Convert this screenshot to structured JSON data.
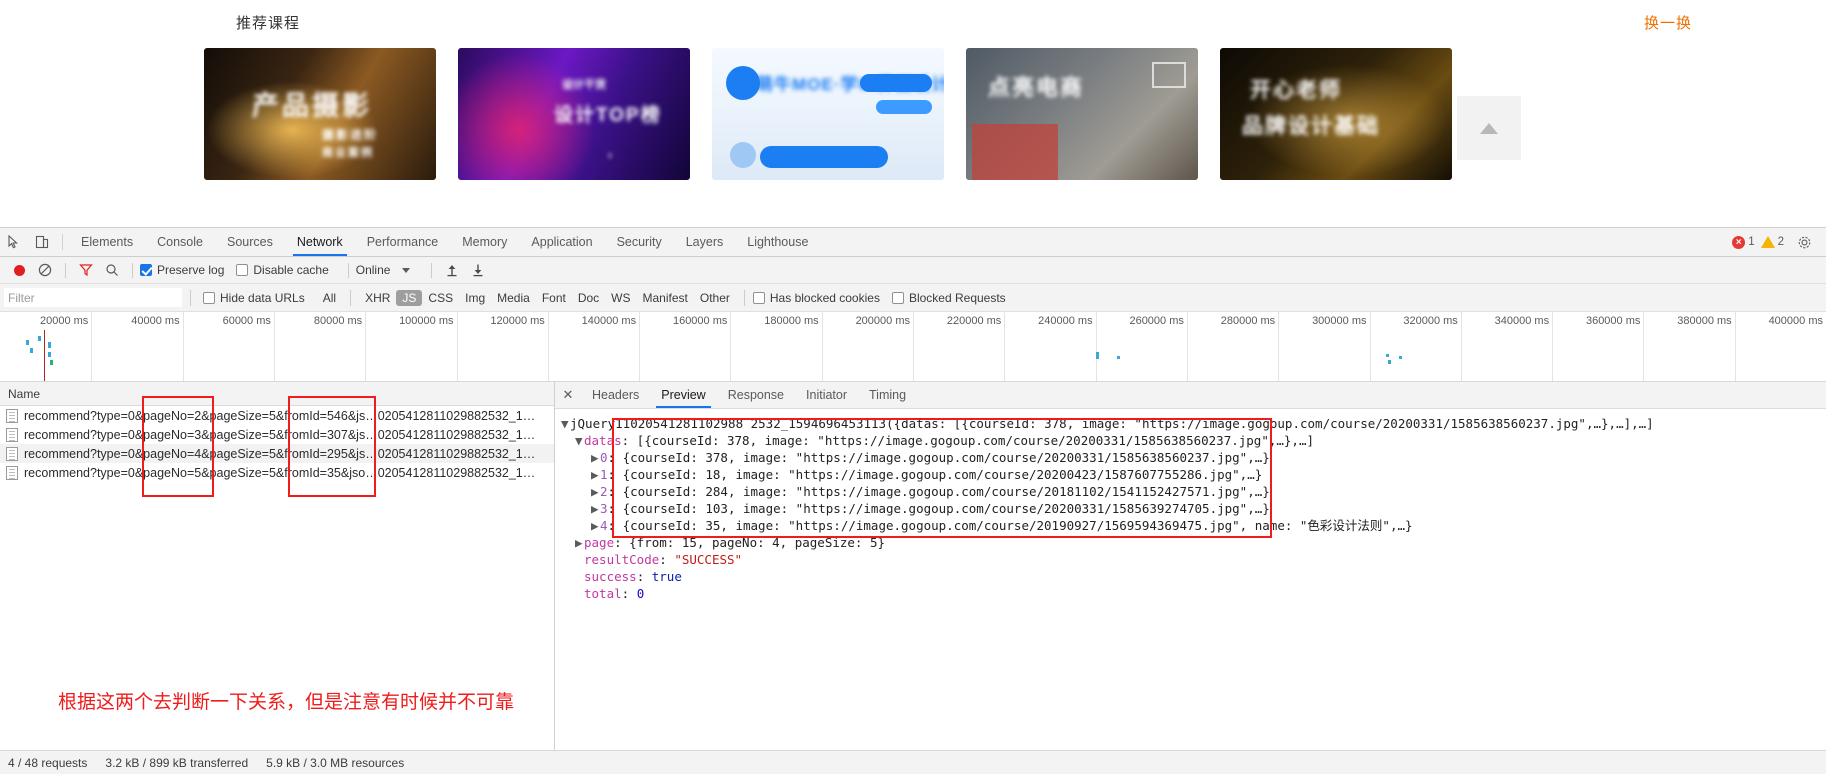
{
  "page": {
    "section_title": "推荐课程",
    "swap_label": "换一换",
    "cards": [
      {
        "name": "card-product-photography",
        "text": "产品摄影"
      },
      {
        "name": "card-design-top",
        "text": "设计TOP榜"
      },
      {
        "name": "card-moe-ui",
        "text": "萌牛MOE·学UI界面设计"
      },
      {
        "name": "card-ecommerce",
        "text": "点亮电商"
      },
      {
        "name": "card-brand-design",
        "text": "开心老师·品牌设计基础"
      }
    ],
    "scroll_top_icon": "scroll-to-top-icon"
  },
  "devtools": {
    "tabs": [
      "Elements",
      "Console",
      "Sources",
      "Network",
      "Performance",
      "Memory",
      "Application",
      "Security",
      "Layers",
      "Lighthouse"
    ],
    "active_tab": "Network",
    "error_count": "1",
    "warning_count": "2",
    "toolbar": {
      "record_title": "record-button",
      "clear_title": "clear-button",
      "filter_title": "filter-toggle",
      "search_title": "search-button",
      "preserve_log_label": "Preserve log",
      "preserve_log_checked": true,
      "disable_cache_label": "Disable cache",
      "disable_cache_checked": false,
      "throttle_value": "Online",
      "import_title": "import-har",
      "export_title": "export-har"
    },
    "filterbar": {
      "filter_placeholder": "Filter",
      "filter_value": "",
      "hide_data_urls_label": "Hide data URLs",
      "hide_data_urls_checked": false,
      "types": [
        "All",
        "XHR",
        "JS",
        "CSS",
        "Img",
        "Media",
        "Font",
        "Doc",
        "WS",
        "Manifest",
        "Other"
      ],
      "selected_type": "JS",
      "has_blocked_cookies_label": "Has blocked cookies",
      "has_blocked_cookies_checked": false,
      "blocked_requests_label": "Blocked Requests",
      "blocked_requests_checked": false
    },
    "overview": {
      "ticks": [
        "20000 ms",
        "40000 ms",
        "60000 ms",
        "80000 ms",
        "100000 ms",
        "120000 ms",
        "140000 ms",
        "160000 ms",
        "180000 ms",
        "200000 ms",
        "220000 ms",
        "240000 ms",
        "260000 ms",
        "280000 ms",
        "300000 ms",
        "320000 ms",
        "340000 ms",
        "360000 ms",
        "380000 ms",
        "400000 ms"
      ]
    },
    "requests": {
      "column_name": "Name",
      "rows": [
        {
          "name": "recommend?type=0&pageNo=2&pageSize=5&fromId=546&js…0205412811029882532_1…",
          "selected": false
        },
        {
          "name": "recommend?type=0&pageNo=3&pageSize=5&fromId=307&js…0205412811029882532_1…",
          "selected": false
        },
        {
          "name": "recommend?type=0&pageNo=4&pageSize=5&fromId=295&js…0205412811029882532_1…",
          "selected": true
        },
        {
          "name": "recommend?type=0&pageNo=5&pageSize=5&fromId=35&jso…0205412811029882532_1…",
          "selected": false
        }
      ]
    },
    "annotation": "根据这两个去判断一下关系，但是注意有时候并不可靠",
    "detail": {
      "tabs": [
        "Headers",
        "Preview",
        "Response",
        "Initiator",
        "Timing"
      ],
      "active_tab": "Preview",
      "close_icon": "close-icon",
      "preview_lines": [
        {
          "indent": 0,
          "twisty": "▼",
          "parts": [
            {
              "t": "jQuery11020541281102988 2532_1594696453113({datas: [{courseId: 378, image: \"https://image.gogoup.com/course/20200331/1585638560237.jpg\",…},…],…]",
              "c": "plain"
            }
          ]
        },
        {
          "indent": 1,
          "twisty": "▼",
          "parts": [
            {
              "t": "datas",
              "c": "key"
            },
            {
              "t": ": [{courseId: 378, image: \"https://image.gogoup.com/course/20200331/1585638560237.jpg\",…},…]",
              "c": "plain"
            }
          ]
        },
        {
          "indent": 2,
          "twisty": "▶",
          "parts": [
            {
              "t": "0",
              "c": "idx"
            },
            {
              "t": ": {courseId: 378, image: \"https://image.gogoup.com/course/20200331/1585638560237.jpg\",…}",
              "c": "plain"
            }
          ]
        },
        {
          "indent": 2,
          "twisty": "▶",
          "parts": [
            {
              "t": "1",
              "c": "idx"
            },
            {
              "t": ": {courseId: 18, image: \"https://image.gogoup.com/course/20200423/1587607755286.jpg\",…}",
              "c": "plain"
            }
          ]
        },
        {
          "indent": 2,
          "twisty": "▶",
          "parts": [
            {
              "t": "2",
              "c": "idx"
            },
            {
              "t": ": {courseId: 284, image: \"https://image.gogoup.com/course/20181102/1541152427571.jpg\",…}",
              "c": "plain"
            }
          ]
        },
        {
          "indent": 2,
          "twisty": "▶",
          "parts": [
            {
              "t": "3",
              "c": "idx"
            },
            {
              "t": ": {courseId: 103, image: \"https://image.gogoup.com/course/20200331/1585639274705.jpg\",…}",
              "c": "plain"
            }
          ]
        },
        {
          "indent": 2,
          "twisty": "▶",
          "parts": [
            {
              "t": "4",
              "c": "idx"
            },
            {
              "t": ": {courseId: 35, image: \"https://image.gogoup.com/course/20190927/1569594369475.jpg\", name: \"色彩设计法则\",…}",
              "c": "plain"
            }
          ]
        },
        {
          "indent": 1,
          "twisty": "▶",
          "parts": [
            {
              "t": "page",
              "c": "key"
            },
            {
              "t": ": {from: 15, pageNo: 4, pageSize: 5}",
              "c": "plain"
            }
          ]
        },
        {
          "indent": 1,
          "twisty": "",
          "parts": [
            {
              "t": "resultCode",
              "c": "key"
            },
            {
              "t": ": ",
              "c": "plain"
            },
            {
              "t": "\"SUCCESS\"",
              "c": "str"
            }
          ]
        },
        {
          "indent": 1,
          "twisty": "",
          "parts": [
            {
              "t": "success",
              "c": "key"
            },
            {
              "t": ": ",
              "c": "plain"
            },
            {
              "t": "true",
              "c": "bool"
            }
          ]
        },
        {
          "indent": 1,
          "twisty": "",
          "parts": [
            {
              "t": "total",
              "c": "key"
            },
            {
              "t": ": ",
              "c": "plain"
            },
            {
              "t": "0",
              "c": "num"
            }
          ]
        }
      ]
    },
    "statusbar": {
      "requests": "4 / 48 requests",
      "transferred": "3.2 kB / 899 kB transferred",
      "resources": "5.9 kB / 3.0 MB resources"
    }
  }
}
